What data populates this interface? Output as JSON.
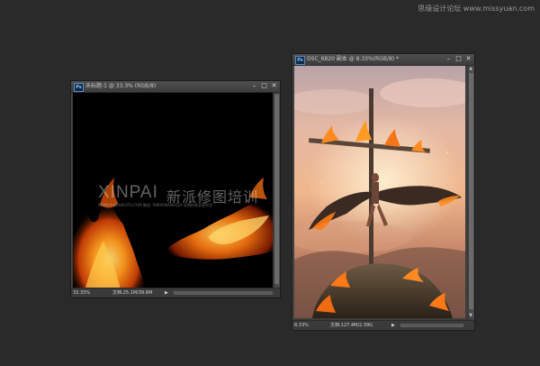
{
  "site_watermark": "思缘设计论坛 www.missyuan.com",
  "left_doc": {
    "title": "未标题-1 @ 33.3% (RGB/8)",
    "zoom": "33.33%",
    "doc_size": "文档:25.1M/39.6M",
    "canvas_watermark": {
      "latin": "XINPAI",
      "chinese": "新派修图培训",
      "small_text": "WWW.XINPAIXIUTU.COM  微信: XINPAIWANG520  长期招收全国学员"
    }
  },
  "right_doc": {
    "title": "DSC_6820 副本 @ 8.33%(RGB/8) *",
    "zoom": "8.33%",
    "doc_size": "文档:127.4M/2.39G"
  },
  "colors": {
    "app_background": "#2a2a2a",
    "panel": "#3c3c3c",
    "ps_icon_blue": "#0f2a49"
  },
  "icons": {
    "app_icon": "ps-icon",
    "minimize": "minimize-icon",
    "maximize": "maximize-icon",
    "close": "close-icon",
    "status_menu": "triangle-right-icon"
  }
}
